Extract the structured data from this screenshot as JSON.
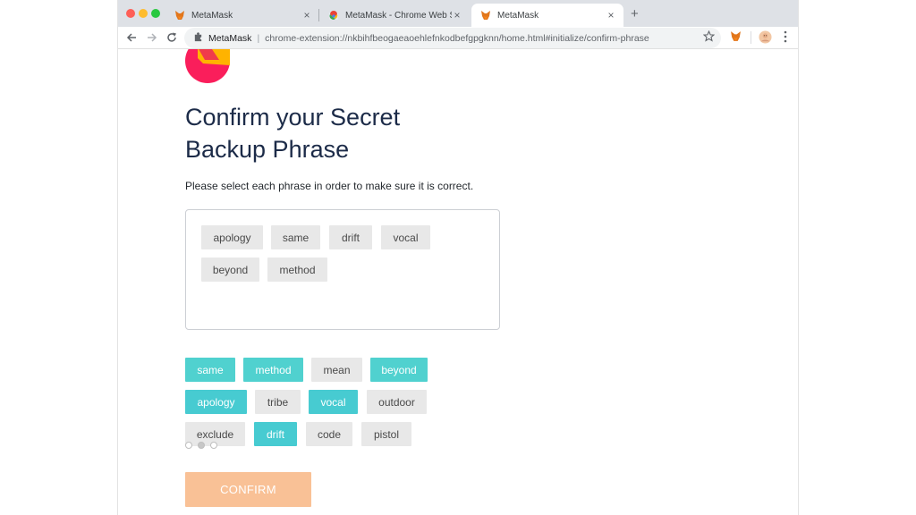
{
  "browser": {
    "tabs": [
      {
        "title": "MetaMask",
        "icon": "metamask-fox-icon",
        "active": false
      },
      {
        "title": "MetaMask - Chrome Web Store",
        "icon": "chrome-web-store-icon",
        "active": false
      },
      {
        "title": "MetaMask",
        "icon": "metamask-fox-icon",
        "active": true
      }
    ],
    "close_glyph": "×",
    "new_tab_glyph": "+",
    "omnibox": {
      "extension_name": "MetaMask",
      "divider": "|",
      "url": "chrome-extension://nkbihfbeogaeaoehlefnkodbefgpgknn/home.html#initialize/confirm-phrase"
    }
  },
  "page": {
    "title_line1": "Confirm your Secret",
    "title_line2": "Backup Phrase",
    "instruction": "Please select each phrase in order to make sure it is correct.",
    "selected_words": [
      "apology",
      "same",
      "drift",
      "vocal",
      "beyond",
      "method"
    ],
    "word_bank": [
      {
        "word": "same",
        "selected": true
      },
      {
        "word": "method",
        "selected": true
      },
      {
        "word": "mean",
        "selected": false
      },
      {
        "word": "beyond",
        "selected": true
      },
      {
        "word": "apology",
        "selected": true
      },
      {
        "word": "tribe",
        "selected": false
      },
      {
        "word": "vocal",
        "selected": true
      },
      {
        "word": "outdoor",
        "selected": false
      },
      {
        "word": "exclude",
        "selected": false
      },
      {
        "word": "drift",
        "selected": true
      },
      {
        "word": "code",
        "selected": false
      },
      {
        "word": "pistol",
        "selected": false
      }
    ],
    "confirm_label": "CONFIRM"
  },
  "colors": {
    "selected_chip": "#50d1cf",
    "unselected_chip": "#e8e8e8",
    "confirm_button": "#f9c196",
    "title_text": "#1c2b48"
  }
}
